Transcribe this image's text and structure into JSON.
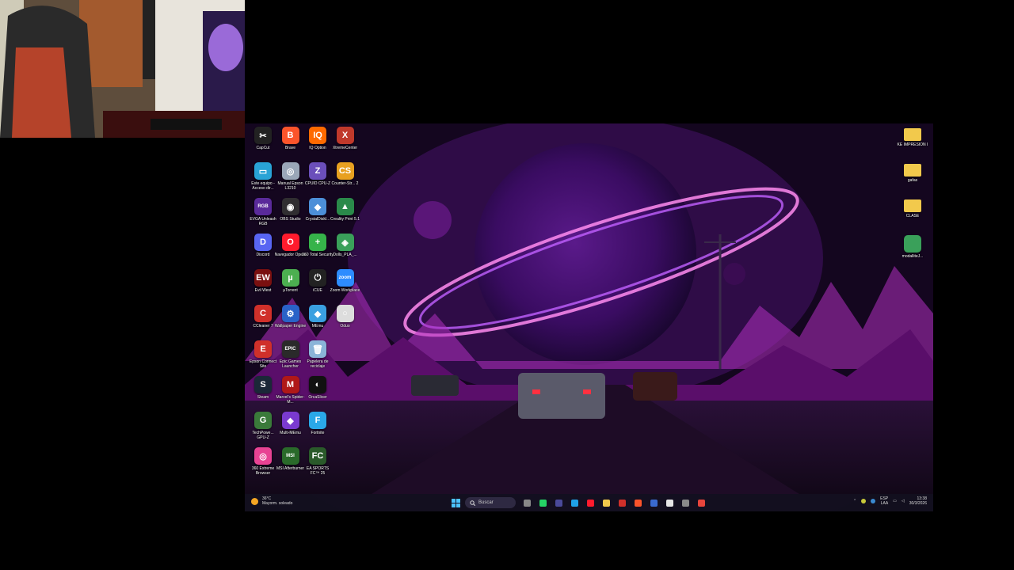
{
  "colors": {
    "desktop_bg": "#1a0830",
    "taskbar_bg": "#141020",
    "accent": "#c044ff"
  },
  "desktop_icons_left": [
    {
      "label": "CapCut",
      "icon": "capcut-icon",
      "color": "#222222",
      "glyph": "✂"
    },
    {
      "label": "Brave",
      "icon": "brave-icon",
      "color": "#fb542b",
      "glyph": "B"
    },
    {
      "label": "IQ Option",
      "icon": "iq-option-icon",
      "color": "#ff6a00",
      "glyph": "IQ"
    },
    {
      "label": "XtremeCenter",
      "icon": "xtremecenter-icon",
      "color": "#c0392b",
      "glyph": "X"
    },
    {
      "label": "Este equipo - Acceso dir...",
      "icon": "this-pc-icon",
      "color": "#29a3d6",
      "glyph": "▭"
    },
    {
      "label": "Manual Epson L3210",
      "icon": "epson-manual-icon",
      "color": "#9aa7b8",
      "glyph": "◎"
    },
    {
      "label": "CPUID CPU-Z",
      "icon": "cpuz-icon",
      "color": "#6b4fbb",
      "glyph": "Z"
    },
    {
      "label": "Counter-Str... 2",
      "icon": "counter-strike-icon",
      "color": "#e8a020",
      "glyph": "CS"
    },
    {
      "label": "EVGA Unleash RGB",
      "icon": "evga-rgb-icon",
      "color": "#5a2a9a",
      "glyph": "RGB"
    },
    {
      "label": "OBS Studio",
      "icon": "obs-icon",
      "color": "#302e31",
      "glyph": "◉"
    },
    {
      "label": "CrystalDiskI...",
      "icon": "crystaldisk-icon",
      "color": "#4c8fd8",
      "glyph": "◆"
    },
    {
      "label": "Creality Print 5.1",
      "icon": "creality-icon",
      "color": "#2a8a4a",
      "glyph": "▲"
    },
    {
      "label": "Discord",
      "icon": "discord-icon",
      "color": "#5865f2",
      "glyph": "D"
    },
    {
      "label": "Navegador Opera",
      "icon": "opera-icon",
      "color": "#ff1b2d",
      "glyph": "O"
    },
    {
      "label": "360 Total Security",
      "icon": "360-security-icon",
      "color": "#36b34a",
      "glyph": "+"
    },
    {
      "label": "Dolls_PLA_...",
      "icon": "dolls-pla-icon",
      "color": "#3aa05a",
      "glyph": "◈"
    },
    {
      "label": "Evil West",
      "icon": "evil-west-icon",
      "color": "#7a1010",
      "glyph": "EW"
    },
    {
      "label": "µTorrent",
      "icon": "utorrent-icon",
      "color": "#4caf50",
      "glyph": "µ"
    },
    {
      "label": "iCUE",
      "icon": "icue-icon",
      "color": "#222222",
      "glyph": "⏻"
    },
    {
      "label": "Zoom Workplace",
      "icon": "zoom-icon",
      "color": "#2d8cff",
      "glyph": "zoom"
    },
    {
      "label": "CCleaner 7",
      "icon": "ccleaner-icon",
      "color": "#d0302a",
      "glyph": "C"
    },
    {
      "label": "Wallpaper Engine",
      "icon": "wallpaper-engine-icon",
      "color": "#2a62c8",
      "glyph": "⚙"
    },
    {
      "label": "MEmu",
      "icon": "memu-icon",
      "color": "#3aa0e0",
      "glyph": "◆"
    },
    {
      "label": "Oduo",
      "icon": "oduo-icon",
      "color": "#dddddd",
      "glyph": "○"
    },
    {
      "label": "Epson Connect Site",
      "icon": "epson-connect-icon",
      "color": "#d0302a",
      "glyph": "E"
    },
    {
      "label": "Epic Games Launcher",
      "icon": "epic-games-icon",
      "color": "#2a2a2a",
      "glyph": "EPIC"
    },
    {
      "label": "Papelera de reciclaje",
      "icon": "recycle-bin-icon",
      "color": "#8ab4d8",
      "glyph": "🗑"
    },
    {
      "label": "",
      "icon": "empty-slot",
      "color": "transparent",
      "glyph": ""
    },
    {
      "label": "Steam",
      "icon": "steam-icon",
      "color": "#1b2838",
      "glyph": "S"
    },
    {
      "label": "Marvel's Spider-M...",
      "icon": "spiderman-icon",
      "color": "#b01818",
      "glyph": "M"
    },
    {
      "label": "OrcaSlicer",
      "icon": "orcaslicer-icon",
      "color": "#111111",
      "glyph": "◐"
    },
    {
      "label": "",
      "icon": "empty-slot",
      "color": "transparent",
      "glyph": ""
    },
    {
      "label": "TechPowe... GPU-Z",
      "icon": "gpuz-icon",
      "color": "#3a7a3a",
      "glyph": "G"
    },
    {
      "label": "Multi-MEmu",
      "icon": "multi-memu-icon",
      "color": "#7a3ad0",
      "glyph": "◆"
    },
    {
      "label": "Fortnite",
      "icon": "fortnite-icon",
      "color": "#2aa8e8",
      "glyph": "F"
    },
    {
      "label": "",
      "icon": "empty-slot",
      "color": "transparent",
      "glyph": ""
    },
    {
      "label": "360 Extreme Browser",
      "icon": "360-browser-icon",
      "color": "#e84393",
      "glyph": "◎"
    },
    {
      "label": "MSI Afterburner",
      "icon": "msi-afterburner-icon",
      "color": "#2a6a2a",
      "glyph": "MSI"
    },
    {
      "label": "EA SPORTS FC™ 25",
      "icon": "ea-fc25-icon",
      "color": "#2a5a2a",
      "glyph": "FC"
    }
  ],
  "desktop_icons_right": [
    {
      "label": "KE IMPRESION I",
      "icon": "folder-icon",
      "color": "#f2c94c"
    },
    {
      "label": "gafas",
      "icon": "folder-icon",
      "color": "#f2c94c"
    },
    {
      "label": "CLASE",
      "icon": "folder-icon",
      "color": "#f2c94c"
    },
    {
      "label": "modalliteJ...",
      "icon": "dolls-pla-icon",
      "color": "#3aa05a"
    }
  ],
  "taskbar": {
    "weather_temp": "36°C",
    "weather_desc": "Mayorm. soleado",
    "search_placeholder": "Buscar",
    "apps": [
      {
        "name": "task-view-icon",
        "color": "#888888"
      },
      {
        "name": "whatsapp-icon",
        "color": "#25d366"
      },
      {
        "name": "terminal-icon",
        "color": "#4a4a9a"
      },
      {
        "name": "edge-icon",
        "color": "#1fa1e8"
      },
      {
        "name": "opera-icon",
        "color": "#ff1b2d"
      },
      {
        "name": "file-explorer-icon",
        "color": "#f2c94c"
      },
      {
        "name": "app-red-icon",
        "color": "#d0302a"
      },
      {
        "name": "brave-icon",
        "color": "#fb542b"
      },
      {
        "name": "app-window-icon",
        "color": "#3a6ad0"
      },
      {
        "name": "notepad-icon",
        "color": "#e6e6e6"
      },
      {
        "name": "camera-icon",
        "color": "#8a8a8a"
      },
      {
        "name": "chrome-icon",
        "color": "#e8453c"
      }
    ],
    "lang": "ESP",
    "lang_sub": "LAA",
    "time": "13:38",
    "date": "30/3/2026"
  }
}
